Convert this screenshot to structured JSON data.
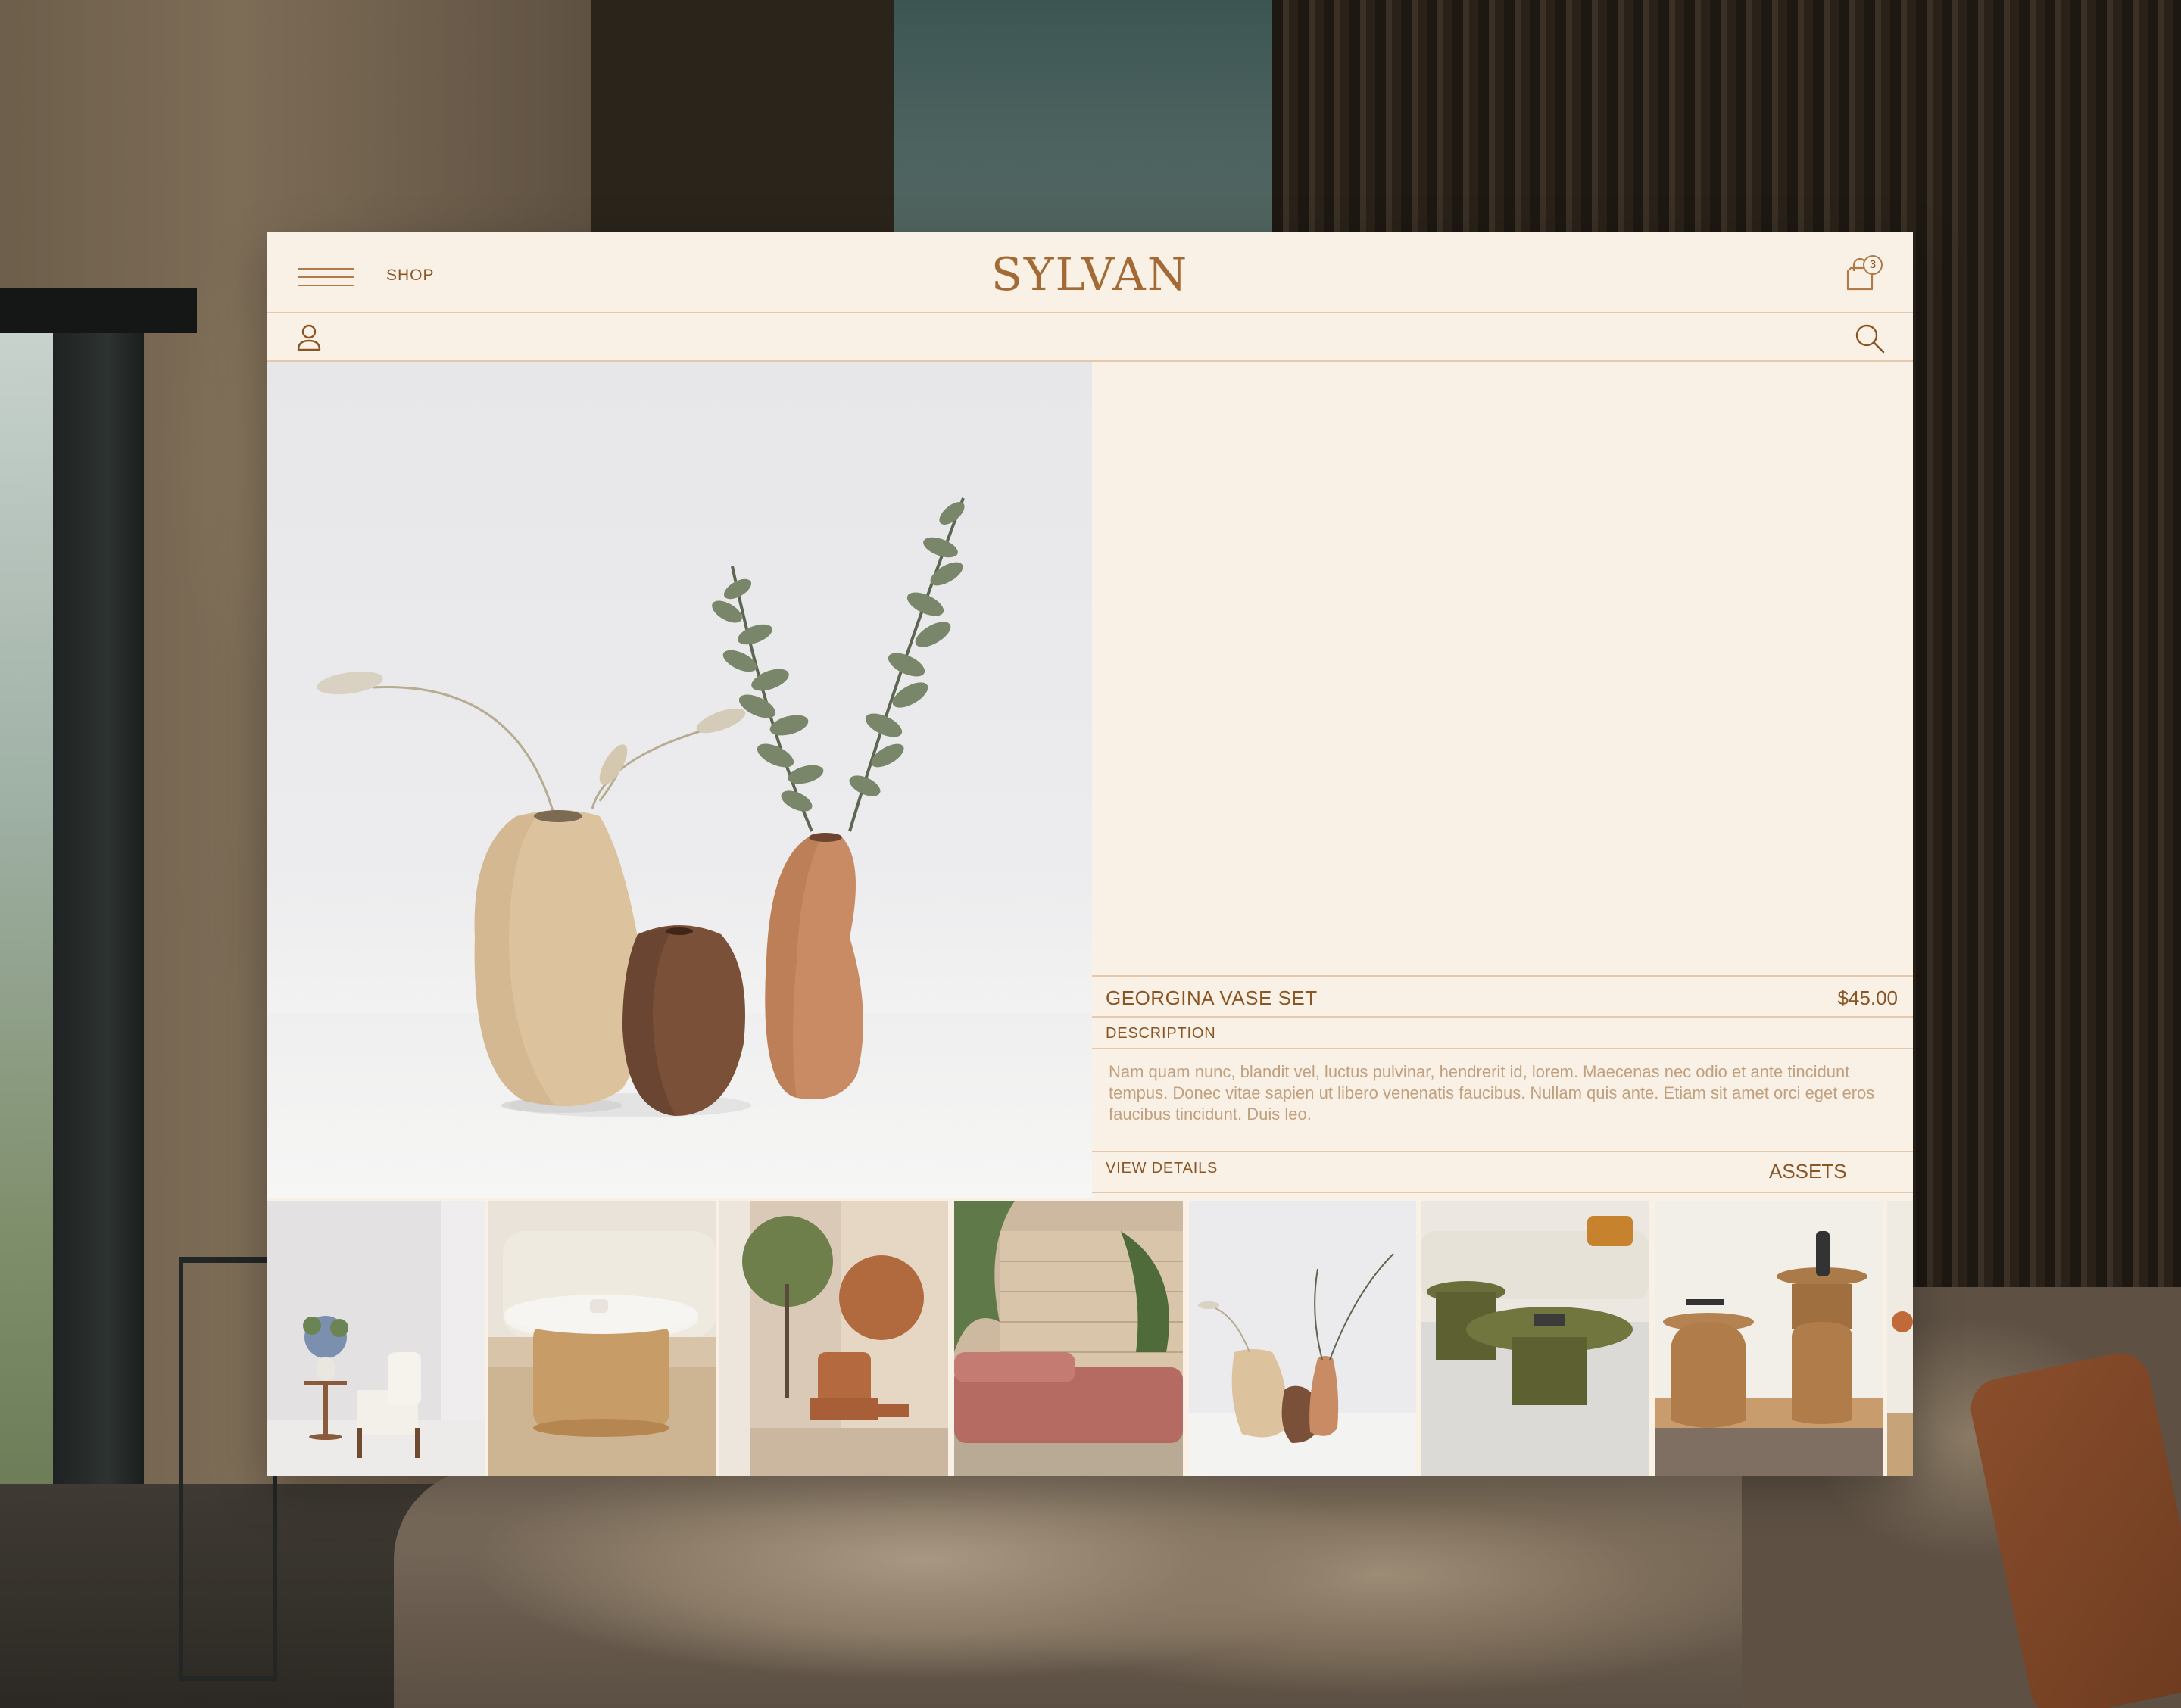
{
  "brand": {
    "logo": "SYLVAN"
  },
  "nav": {
    "shop_label": "SHOP",
    "menu_icon": "hamburger-menu-icon",
    "user_icon": "user-icon",
    "search_icon": "search-icon",
    "cart_icon": "shopping-bag-icon",
    "cart_count": "3"
  },
  "product": {
    "name": "GEORGINA VASE SET",
    "price": "$45.00",
    "description_heading": "DESCRIPTION",
    "description": "Nam quam nunc, blandit vel, luctus pulvinar, hendrerit id, lorem. Maecenas nec odio et ante tincidunt tempus. Donec vitae sapien ut libero venenatis faucibus. Nullam quis ante. Etiam sit amet orci eget eros faucibus tincidunt. Duis leo.",
    "view_details_label": "VIEW DETAILS",
    "assets_label": "ASSETS"
  },
  "thumbnails": [
    {
      "subject": "white-chair-with-flowers"
    },
    {
      "subject": "round-coffee-table-and-sofa"
    },
    {
      "subject": "lounge-chair-with-round-art"
    },
    {
      "subject": "pink-sectional-sofa-with-plants"
    },
    {
      "subject": "three-vases-with-eucalyptus"
    },
    {
      "subject": "green-coffee-tables"
    },
    {
      "subject": "wooden-side-tables"
    },
    {
      "subject": "partial-interior"
    }
  ],
  "colors": {
    "panel_bg": "#faf1e6",
    "accent_brown": "#8a5524",
    "divider": "#e6c9ac",
    "body_text": "#c0a07f"
  }
}
